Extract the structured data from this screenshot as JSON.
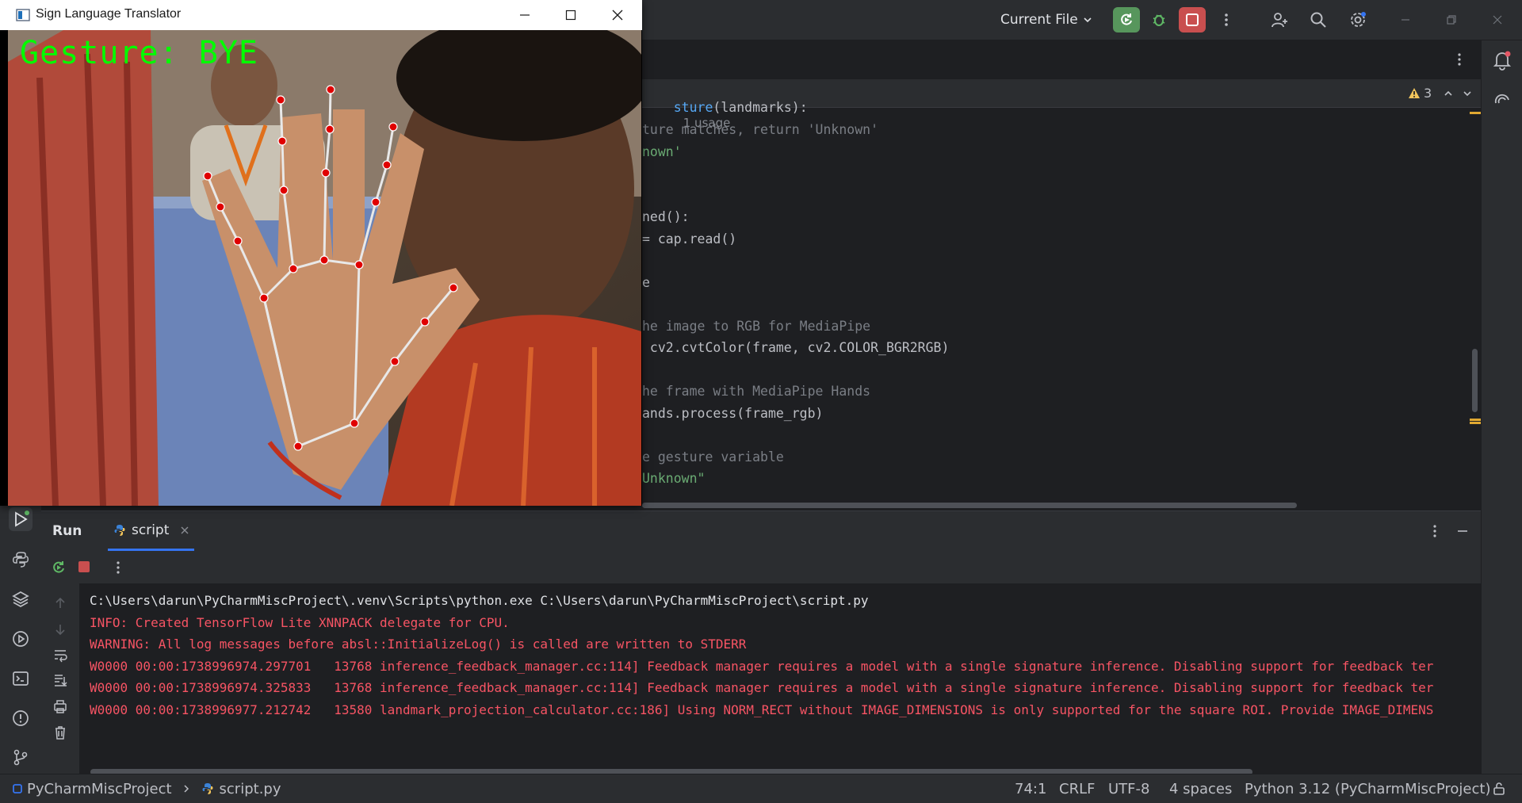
{
  "toolbar": {
    "run_config_label": "Current File"
  },
  "editor": {
    "breadcrumb_func": "sture",
    "breadcrumb_params": "(landmarks):",
    "usage_label": "1 usage",
    "warning_count": "3",
    "code_lines": [
      {
        "text": "ture matches, return 'Unknown'",
        "kind": "com"
      },
      {
        "text": "nown'",
        "kind": "str"
      },
      {
        "text": "",
        "kind": "def"
      },
      {
        "text": "",
        "kind": "def"
      },
      {
        "text": "ned():",
        "kind": "def"
      },
      {
        "text": "= cap.read()",
        "kind": "def"
      },
      {
        "text": "",
        "kind": "def"
      },
      {
        "text": "e",
        "kind": "def"
      },
      {
        "text": "",
        "kind": "def"
      },
      {
        "text": "he image to RGB for MediaPipe",
        "kind": "com"
      },
      {
        "text": " cv2.cvtColor(frame, cv2.COLOR_BGR2RGB)",
        "kind": "def"
      },
      {
        "text": "",
        "kind": "def"
      },
      {
        "text": "he frame with MediaPipe Hands",
        "kind": "com"
      },
      {
        "text": "ands.process(frame_rgb)",
        "kind": "def"
      },
      {
        "text": "",
        "kind": "def"
      },
      {
        "text": "e gesture variable",
        "kind": "com"
      },
      {
        "text": "Unknown\"",
        "kind": "str"
      }
    ]
  },
  "run_panel": {
    "run_tab_label": "Run",
    "script_tab_label": "script",
    "console_lines": [
      {
        "text": "C:\\Users\\darun\\PyCharmMiscProject\\.venv\\Scripts\\python.exe C:\\Users\\darun\\PyCharmMiscProject\\script.py",
        "kind": "out"
      },
      {
        "text": "INFO: Created TensorFlow Lite XNNPACK delegate for CPU.",
        "kind": "err"
      },
      {
        "text": "WARNING: All log messages before absl::InitializeLog() is called are written to STDERR",
        "kind": "err"
      },
      {
        "text": "W0000 00:00:1738996974.297701   13768 inference_feedback_manager.cc:114] Feedback manager requires a model with a single signature inference. Disabling support for feedback ter",
        "kind": "err"
      },
      {
        "text": "W0000 00:00:1738996974.325833   13768 inference_feedback_manager.cc:114] Feedback manager requires a model with a single signature inference. Disabling support for feedback ter",
        "kind": "err"
      },
      {
        "text": "W0000 00:00:1738996977.212742   13580 landmark_projection_calculator.cc:186] Using NORM_RECT without IMAGE_DIMENSIONS is only supported for the square ROI. Provide IMAGE_DIMENS",
        "kind": "err"
      }
    ]
  },
  "statusbar": {
    "project": "PyCharmMiscProject",
    "file": "script.py",
    "position": "74:1",
    "line_sep": "CRLF",
    "encoding": "UTF-8",
    "indent": "4 spaces",
    "interpreter": "Python 3.12 (PyCharmMiscProject)"
  },
  "cam_window": {
    "title": "Sign Language Translator",
    "gesture_text": "Gesture: BYE"
  },
  "colors": {
    "accent_run": "#57965c",
    "stop_red": "#c94f4f",
    "gesture_green": "#00ff00",
    "error_text": "#f75464"
  },
  "icons": [
    "app-icon",
    "chevron-down-icon",
    "rerun-icon",
    "debug-icon",
    "stop-icon",
    "more-vert-icon",
    "add-user-icon",
    "search-icon",
    "settings-icon",
    "minimize-icon",
    "restore-icon",
    "close-icon",
    "notifications-icon",
    "ai-assistant-icon",
    "run-tool-icon",
    "python-console-icon",
    "layers-icon",
    "services-icon",
    "terminal-icon",
    "problems-icon",
    "git-icon",
    "python-file-icon",
    "lock-icon"
  ]
}
